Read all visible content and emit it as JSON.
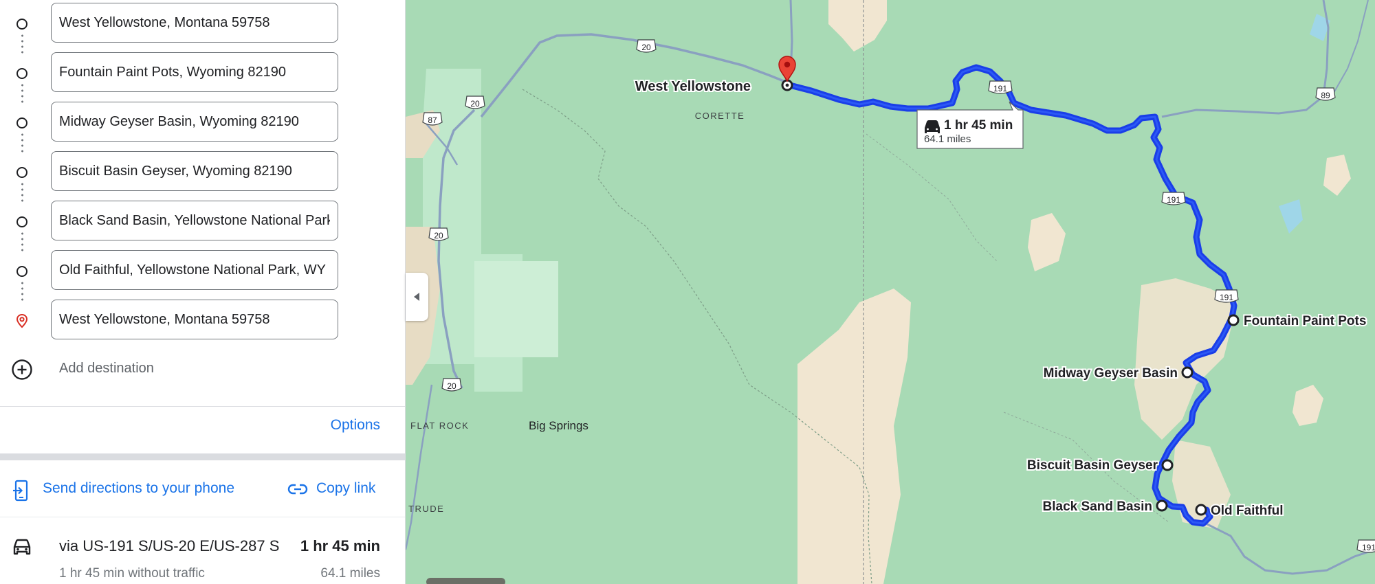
{
  "directions": {
    "stops": [
      {
        "value": "West Yellowstone, Montana 59758"
      },
      {
        "value": "Fountain Paint Pots, Wyoming 82190"
      },
      {
        "value": "Midway Geyser Basin, Wyoming 82190"
      },
      {
        "value": "Biscuit Basin Geyser, Wyoming 82190"
      },
      {
        "value": "Black Sand Basin, Yellowstone National Park"
      },
      {
        "value": "Old Faithful, Yellowstone National Park, WY"
      },
      {
        "value": "West Yellowstone, Montana 59758"
      }
    ],
    "add_destination": "Add destination",
    "options": "Options",
    "send_to_phone": "Send directions to your phone",
    "copy_link": "Copy link"
  },
  "route": {
    "via": "via US-191 S/US-20 E/US-287 S",
    "duration": "1 hr 45 min",
    "traffic_note": "1 hr 45 min without traffic",
    "distance": "64.1 miles"
  },
  "map": {
    "callout": {
      "duration": "1 hr 45 min",
      "distance": "64.1 miles"
    },
    "places": {
      "west_yellowstone": "West Yellowstone",
      "corette": "CORETTE",
      "flat_rock": "FLAT ROCK",
      "big_springs": "Big Springs",
      "trude": "TRUDE"
    },
    "stop_labels": {
      "fountain": "Fountain Paint Pots",
      "midway": "Midway Geyser Basin",
      "biscuit": "Biscuit Basin Geyser",
      "black_sand": "Black Sand Basin",
      "old_faithful": "Old Faithful"
    },
    "shields": {
      "us20": "20",
      "us191": "191",
      "us87": "87",
      "us89": "89"
    },
    "colors": {
      "forest": "#a8dab5",
      "sand": "#f1e6d1",
      "route": "#1a3ee8",
      "pin": "#d93025",
      "road": "#8aa0c0"
    }
  }
}
